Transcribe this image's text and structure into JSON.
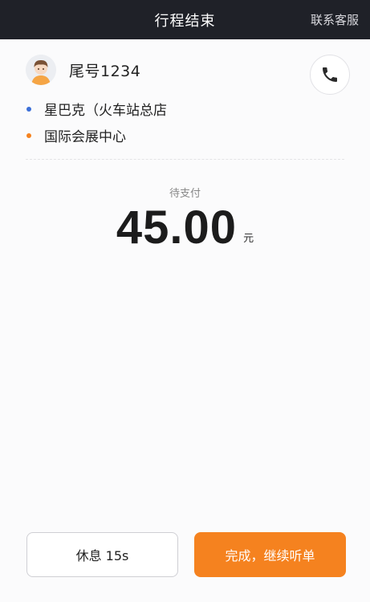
{
  "header": {
    "title": "行程结束",
    "service_link": "联系客服"
  },
  "passenger": {
    "tail_number": "尾号1234",
    "avatar_icon": "user-avatar-icon",
    "phone_icon": "phone-icon"
  },
  "route": {
    "start": {
      "label": "星巴克（火车站总店",
      "dot_color": "#3b6fd8"
    },
    "end": {
      "label": "国际会展中心",
      "dot_color": "#f5821f"
    }
  },
  "payment": {
    "label": "待支付",
    "amount": "45.00",
    "unit": "元"
  },
  "actions": {
    "rest_label": "休息 15s",
    "done_label": "完成，继续听单"
  },
  "colors": {
    "header_bg": "#1f2128",
    "accent": "#f5821f"
  }
}
